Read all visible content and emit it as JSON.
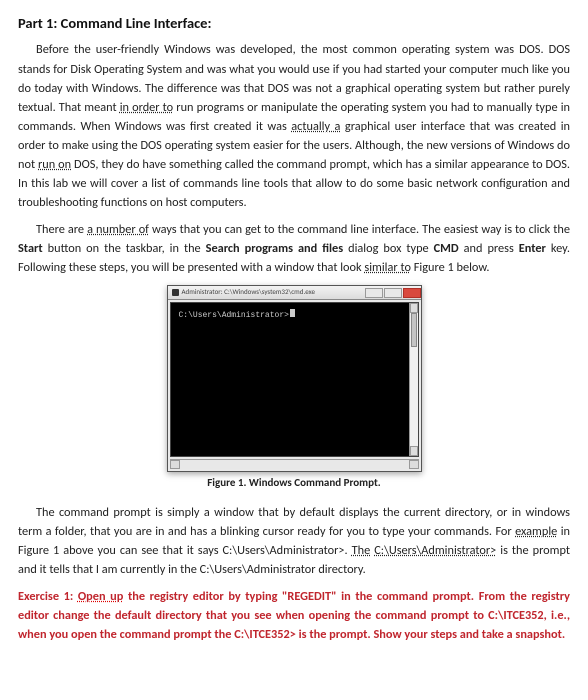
{
  "heading": "Part 1: Command Line Interface:",
  "para1_a": "Before the user-friendly Windows was developed, the most common operating system was DOS. DOS stands for Disk Operating System and was what you would use if you had started your computer much like you do today with Windows. The difference was that DOS was not a graphical operating system but rather purely textual. That meant ",
  "para1_u1": "in order to",
  "para1_b": " run programs or manipulate the operating system you had to manually type in commands. When Windows was first created it was ",
  "para1_u2": "actually a",
  "para1_c": " graphical user interface that was created in order to make using the DOS operating system easier for the users. Although, the new versions of Windows do not ",
  "para1_u3": "run on",
  "para1_d": " DOS, they do have something called the command prompt, which has a similar appearance to DOS. In this lab we will cover a list of commands line tools that allow to do some basic network configuration and troubleshooting functions on host computers.",
  "para2_a": "There are ",
  "para2_u1": "a number of",
  "para2_b": " ways that you can get to the command line interface. The easiest way is to click the ",
  "para2_s1": "Start",
  "para2_c": " button on the taskbar, in the ",
  "para2_s2": "Search programs and files",
  "para2_d": " dialog box type ",
  "para2_s3": "CMD",
  "para2_e": " and press ",
  "para2_s4": "Enter",
  "para2_f": " key. Following these steps, you will be presented with a window that look ",
  "para2_u2": "similar to",
  "para2_g": " Figure 1 below.",
  "cmd_title": "Administrator: C:\\Windows\\system32\\cmd.exe",
  "cmd_prompt": "C:\\Users\\Administrator>",
  "caption": "Figure 1. Windows Command Prompt.",
  "para3_a": "The command prompt is simply a window that by default displays the current directory, or in windows term a folder, that you are in and has a blinking cursor ready for you to type your commands. For ",
  "para3_u1": "example",
  "para3_b": " in Figure 1 above you can see that it says C:\\Users\\Administrator>. ",
  "para3_u2": "The",
  "para3_c": " ",
  "para3_u3": "C:\\Users\\Administrator>",
  "para3_d": " is the prompt and it tells that I am currently in the C:\\Users\\Administrator directory.",
  "ex_a": "Exercise 1: ",
  "ex_u1": "Open up",
  "ex_b": " the registry editor by typing \"REGEDIT\" in the command prompt. From the registry editor change the default directory that you see when opening the command prompt to C:\\ITCE352, i.e., when you open the command prompt the C:\\ITCE352> is the prompt. Show your steps and take a snapshot."
}
